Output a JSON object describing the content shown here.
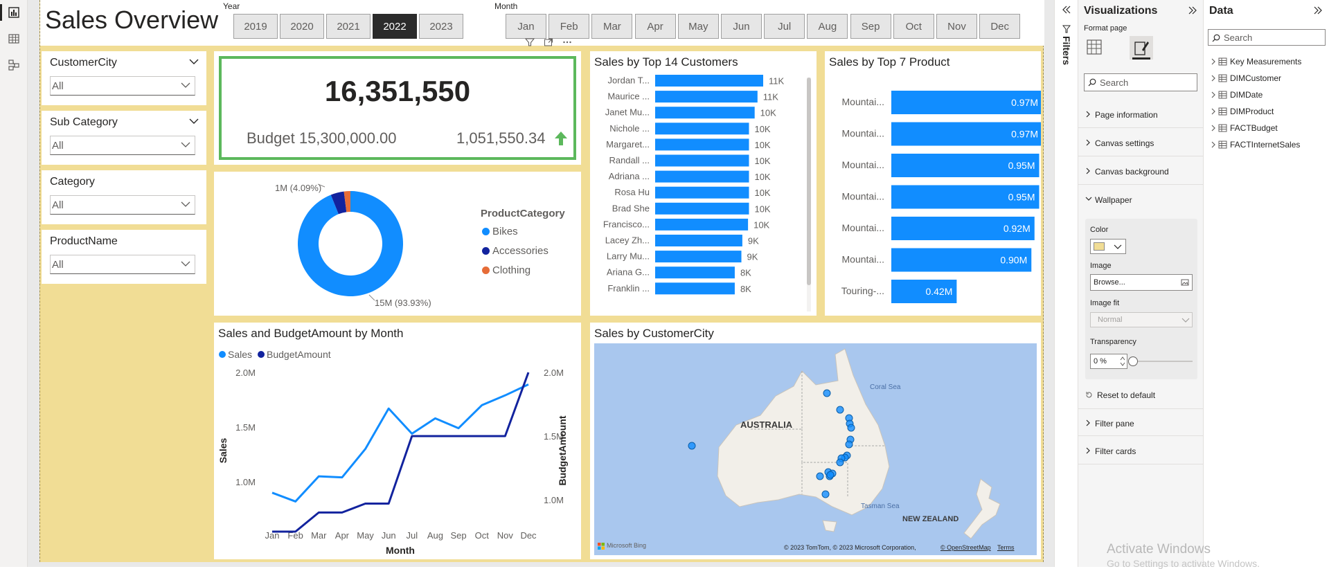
{
  "report": {
    "title": "Sales Overview",
    "year_label": "Year",
    "years": [
      "2019",
      "2020",
      "2021",
      "2022",
      "2023"
    ],
    "selected_year": "2022",
    "month_label": "Month",
    "months": [
      "Jan",
      "Feb",
      "Mar",
      "Apr",
      "May",
      "Jun",
      "Jul",
      "Aug",
      "Sep",
      "Oct",
      "Nov",
      "Dec"
    ]
  },
  "slicers": [
    {
      "label": "CustomerCity",
      "value": "All"
    },
    {
      "label": "Sub Category",
      "value": "All"
    },
    {
      "label": "Category",
      "value": "All"
    },
    {
      "label": "ProductName",
      "value": "All"
    }
  ],
  "kpi": {
    "value": "16,351,550",
    "goal_text": "Budget 15,300,000.00",
    "variance": "1,051,550.34"
  },
  "donut": {
    "legend_title": "ProductCategory",
    "label_top": "1M (4.09%)",
    "label_bottom": "15M (93.93%)"
  },
  "customers_chart": {
    "title": "Sales by Top 14 Customers"
  },
  "products_chart": {
    "title": "Sales by Top 7 Product"
  },
  "line_chart": {
    "title": "Sales and BudgetAmount by Month",
    "x_title": "Month",
    "y_left_title": "Sales",
    "y_right_title": "BudgetAmount"
  },
  "map": {
    "title": "Sales by CustomerCity",
    "labels": {
      "australia": "AUSTRALIA",
      "nz": "NEW ZEALAND",
      "coral": "Coral Sea",
      "tasman": "Tasman Sea"
    },
    "bing": "Microsoft Bing",
    "copyright": "© 2023 TomTom, © 2023 Microsoft Corporation,",
    "osm": "© OpenStreetMap",
    "terms": "Terms"
  },
  "chart_data": [
    {
      "type": "pie",
      "name": "donut",
      "legend_title": "ProductCategory",
      "slices": [
        {
          "name": "Bikes",
          "value": 93.93,
          "color": "#118DFF"
        },
        {
          "name": "Accessories",
          "value": 4.09,
          "color": "#12239E"
        },
        {
          "name": "Clothing",
          "value": 1.98,
          "color": "#E66C37"
        }
      ]
    },
    {
      "type": "bar",
      "name": "customers",
      "title": "Sales by Top 14 Customers",
      "categories": [
        "Jordan T...",
        "Maurice ...",
        "Janet Mu...",
        "Nichole ...",
        "Margaret...",
        "Randall ...",
        "Adriana ...",
        "Rosa Hu",
        "Brad She",
        "Francisco...",
        "Lacey Zh...",
        "Larry Mu...",
        "Ariana G...",
        "Franklin ..."
      ],
      "values": [
        11400,
        10800,
        10500,
        9900,
        9900,
        9900,
        9900,
        9900,
        9900,
        9800,
        9200,
        9100,
        8400,
        8400
      ],
      "value_labels": [
        "11K",
        "11K",
        "10K",
        "10K",
        "10K",
        "10K",
        "10K",
        "10K",
        "10K",
        "10K",
        "9K",
        "9K",
        "8K",
        "8K"
      ],
      "xlim": [
        0,
        11400
      ]
    },
    {
      "type": "bar",
      "name": "products",
      "title": "Sales by Top 7 Product",
      "categories": [
        "Mountai...",
        "Mountai...",
        "Mountai...",
        "Mountai...",
        "Mountai...",
        "Mountai...",
        "Touring-..."
      ],
      "values": [
        0.97,
        0.97,
        0.95,
        0.95,
        0.92,
        0.9,
        0.42
      ],
      "value_labels": [
        "0.97M",
        "0.97M",
        "0.95M",
        "0.95M",
        "0.92M",
        "0.90M",
        "0.42M"
      ],
      "xlim": [
        0,
        0.97
      ]
    },
    {
      "type": "line",
      "name": "sales_budget",
      "title": "Sales and BudgetAmount by Month",
      "categories": [
        "Jan",
        "Feb",
        "Mar",
        "Apr",
        "May",
        "Jun",
        "Jul",
        "Aug",
        "Sep",
        "Oct",
        "Nov",
        "Dec"
      ],
      "series": [
        {
          "name": "Sales",
          "color": "#118DFF",
          "axis": "left",
          "values": [
            0.9,
            0.82,
            1.05,
            1.04,
            1.3,
            1.67,
            1.44,
            1.58,
            1.49,
            1.7,
            1.79,
            1.89
          ]
        },
        {
          "name": "BudgetAmount",
          "color": "#12239E",
          "axis": "right",
          "values": [
            0.75,
            0.75,
            0.9,
            0.9,
            0.97,
            0.97,
            1.5,
            1.5,
            1.5,
            1.5,
            1.5,
            2.0
          ]
        }
      ],
      "y_left": {
        "ticks": [
          "1.0M",
          "1.5M",
          "2.0M"
        ],
        "values": [
          1.0,
          1.5,
          2.0
        ]
      },
      "y_right": {
        "ticks": [
          "1.0M",
          "1.5M",
          "2.0M"
        ],
        "values": [
          1.0,
          1.5,
          2.0
        ]
      },
      "xlabel": "Month",
      "ylabel": "Sales",
      "ylabel_right": "BudgetAmount"
    }
  ],
  "filters_pane": {
    "label": "Filters"
  },
  "viz_pane": {
    "title": "Visualizations",
    "format_page": "Format page",
    "search_placeholder": "Search",
    "sections": [
      "Page information",
      "Canvas settings",
      "Canvas background",
      "Wallpaper",
      "Filter pane",
      "Filter cards"
    ],
    "wallpaper": {
      "color_label": "Color",
      "color_value": "#F1DD95",
      "image_label": "Image",
      "browse": "Browse...",
      "fit_label": "Image fit",
      "fit_value": "Normal",
      "transparency_label": "Transparency",
      "transparency_value": "0 %",
      "reset": "Reset to default"
    }
  },
  "data_pane": {
    "title": "Data",
    "search_placeholder": "Search",
    "tables": [
      "Key Measurements",
      "DIMCustomer",
      "DIMDate",
      "DIMProduct",
      "FACTBudget",
      "FACTInternetSales"
    ]
  },
  "os": {
    "activate": "Activate Windows",
    "activate_sub": "Go to Settings to activate Windows."
  }
}
